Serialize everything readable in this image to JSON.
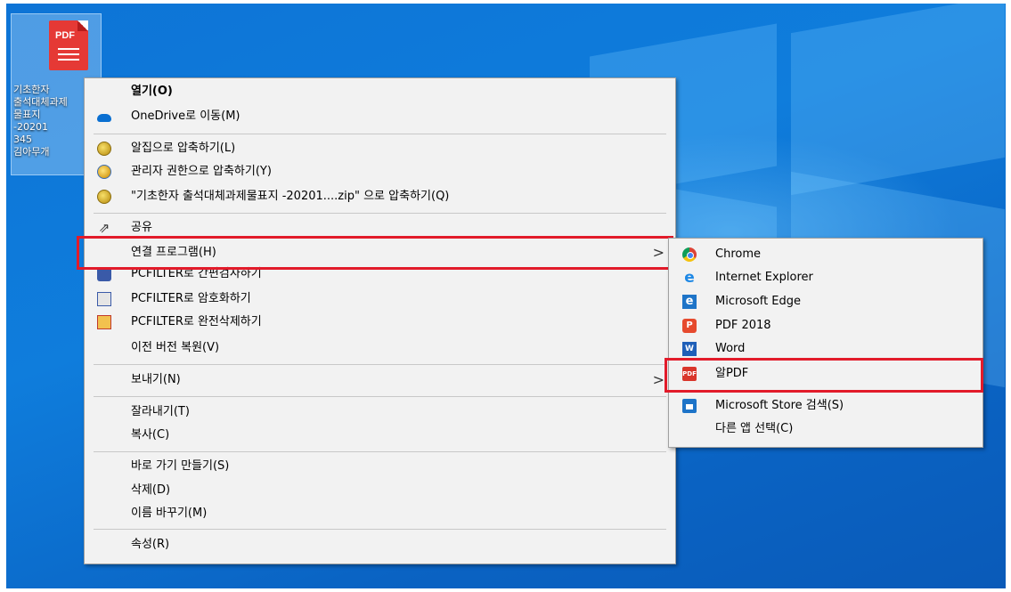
{
  "desktop": {
    "file_icon_text": "PDF",
    "file_label_lines": [
      "기초한자",
      "출석대체과제",
      "물표지",
      "-20201",
      "345",
      "김아무개"
    ]
  },
  "context_menu": {
    "items": [
      {
        "label": "열기(O)",
        "icon": "",
        "bold": true
      },
      {
        "label": "OneDrive로 이동(M)",
        "icon": "cloud-icon"
      },
      {
        "label": "알집으로 압축하기(L)",
        "icon": "alzip-icon"
      },
      {
        "label": "관리자 권한으로 압축하기(Y)",
        "icon": "alzip-admin-icon"
      },
      {
        "label": "\"기초한자 출석대체과제물표지 -20201....zip\" 으로 압축하기(Q)",
        "icon": "alzip-icon"
      },
      {
        "label": "공유",
        "icon": "share-icon"
      },
      {
        "label": "연결 프로그램(H)",
        "icon": "",
        "has_submenu": true,
        "highlighted": true
      },
      {
        "label": "PCFILTER로 간편검사하기",
        "icon": "pcfilter-icon"
      },
      {
        "label": "PCFILTER로 암호화하기",
        "icon": "pcfilter-encrypt-icon"
      },
      {
        "label": "PCFILTER로 완전삭제하기",
        "icon": "pcfilter-delete-icon"
      },
      {
        "label": "이전 버전 복원(V)",
        "icon": ""
      },
      {
        "label": "보내기(N)",
        "icon": "",
        "has_submenu": true
      },
      {
        "label": "잘라내기(T)",
        "icon": ""
      },
      {
        "label": "복사(C)",
        "icon": ""
      },
      {
        "label": "바로 가기 만들기(S)",
        "icon": ""
      },
      {
        "label": "삭제(D)",
        "icon": ""
      },
      {
        "label": "이름 바꾸기(M)",
        "icon": ""
      },
      {
        "label": "속성(R)",
        "icon": ""
      }
    ]
  },
  "open_with_submenu": {
    "items": [
      {
        "label": "Chrome",
        "icon": "chrome-icon"
      },
      {
        "label": "Internet Explorer",
        "icon": "internet-explorer-icon"
      },
      {
        "label": "Microsoft Edge",
        "icon": "edge-icon"
      },
      {
        "label": "PDF 2018",
        "icon": "pdf-2018-icon"
      },
      {
        "label": "Word",
        "icon": "word-icon"
      },
      {
        "label": "알PDF",
        "icon": "alpdf-icon",
        "highlighted": true
      },
      {
        "label": "Microsoft Store 검색(S)",
        "icon": "store-icon"
      },
      {
        "label": "다른 앱 선택(C)",
        "icon": ""
      }
    ]
  },
  "colors": {
    "highlight_border": "#e21b2a",
    "menu_background": "#f2f2f2",
    "desktop_blue": "#0f7ddc"
  }
}
